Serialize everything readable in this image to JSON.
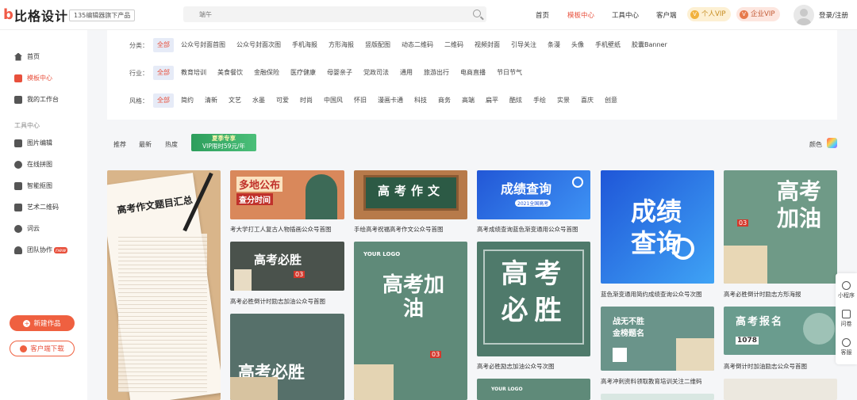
{
  "header": {
    "logo_mark": "b",
    "logo_text": "比格设计",
    "slogan": "135编辑器旗下产品",
    "search_value": "端午",
    "nav": [
      "首页",
      "模板中心",
      "工具中心",
      "客户端"
    ],
    "vip_personal": "个人VIP",
    "vip_enterprise": "企业VIP",
    "login": "登录/注册"
  },
  "sidebar": {
    "items": [
      "首页",
      "模板中心",
      "我的工作台"
    ],
    "tools_title": "工具中心",
    "tools": [
      "图片编辑",
      "在线拼图",
      "智能抠图",
      "艺术二维码",
      "词云",
      "团队协作"
    ],
    "new_badge": "new",
    "create_button": "新建作品",
    "download_button": "客户端下载"
  },
  "filters": {
    "category_label": "分类：",
    "categories": [
      "全部",
      "公众号封面首图",
      "公众号封面次图",
      "手机海报",
      "方形海报",
      "竖版配图",
      "动态二维码",
      "二维码",
      "视频封面",
      "引导关注",
      "条漫",
      "头像",
      "手机壁纸",
      "胶囊Banner"
    ],
    "industry_label": "行业：",
    "industries": [
      "全部",
      "教育培训",
      "美食餐饮",
      "金融保险",
      "医疗健康",
      "母婴亲子",
      "党政司法",
      "通用",
      "旅游出行",
      "电商直播",
      "节日节气"
    ],
    "style_label": "风格：",
    "styles": [
      "全部",
      "简约",
      "清新",
      "文艺",
      "水墨",
      "可爱",
      "时尚",
      "中国风",
      "怀旧",
      "漫画卡通",
      "科技",
      "商务",
      "高端",
      "扁平",
      "酷炫",
      "手绘",
      "实景",
      "喜庆",
      "创意"
    ]
  },
  "sortbar": {
    "options": [
      "推荐",
      "最新",
      "热度"
    ],
    "promo_line1": "夏季专享",
    "promo_line2": "VIP限时59元/年",
    "color_label": "颜色"
  },
  "cards": {
    "c1_title": "高考作文题目汇总",
    "c2_title_line1": "多地公布",
    "c2_title_line2": "查分时间",
    "c2_caption": "考大学打工人复古人物插画公众号首图",
    "c3_title": "高考作文",
    "c3_caption": "手绘高考祝福高考作文公众号首图",
    "c4_title": "成绩查询",
    "c4_sub": "2021全国高考",
    "c4_caption": "高考成绩查询蓝色渐变通用公众号首图",
    "c5_title": "成绩查询",
    "c5_caption": "蓝色渐变通用简约成绩查询公众号次图",
    "c6_title": "高考加油",
    "c6_num": "03",
    "c6_caption": "高考必胜倒计时励志方形海报",
    "c7_title": "高考必胜",
    "c7_num": "03",
    "c7_caption": "高考必胜倒计时励志加油公众号首图",
    "c8_logo": "YOUR LOGO",
    "c8_title": "高考加油",
    "c8_num": "03",
    "c9_title": "高考必胜",
    "c9_caption": "高考必胜励志加油公众号次图",
    "c10_title_line1": "战无不胜",
    "c10_title_line2": "金榜题名",
    "c10_caption": "高考冲刺资料领取教育培训关注二维码",
    "c11_title": "高考报名",
    "c11_num": "1078",
    "c11_caption": "高考倒计时加油励志公众号首图",
    "c12_title": "高考必胜",
    "c13_logo": "YOUR LOGO"
  },
  "floatbar": [
    "小程序",
    "问卷",
    "客服"
  ]
}
